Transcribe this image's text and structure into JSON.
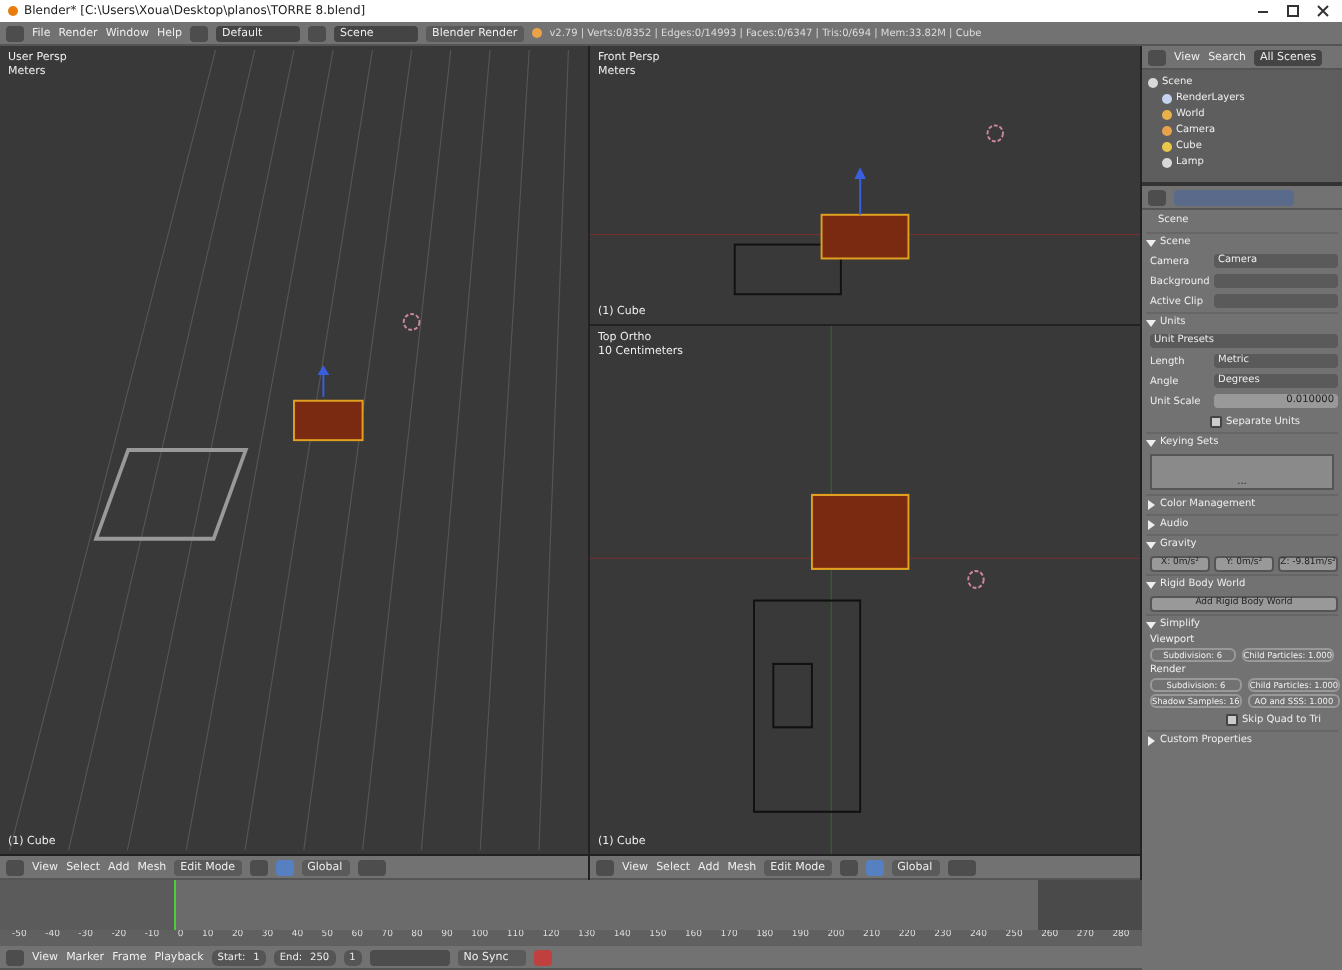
{
  "window": {
    "title": "Blender* [C:\\Users\\Xoua\\Desktop\\planos\\TORRE 8.blend]"
  },
  "info_header": {
    "menus": [
      "File",
      "Render",
      "Window",
      "Help"
    ],
    "layout": "Default",
    "scene": "Scene",
    "engine": "Blender Render",
    "stats": "v2.79 | Verts:0/8352 | Edges:0/14993 | Faces:0/6347 | Tris:0/694 | Mem:33.82M | Cube"
  },
  "viewports": [
    {
      "title": "User Persp",
      "units": "Meters",
      "object": "(1) Cube",
      "kind": "persp"
    },
    {
      "title": "Front Persp",
      "units": "Meters",
      "object": "(1) Cube",
      "kind": "front"
    },
    {
      "title": "Top Ortho",
      "units": "10 Centimeters",
      "object": "(1) Cube",
      "kind": "top"
    }
  ],
  "view3d_headers": [
    {
      "menus": [
        "View",
        "Select",
        "Add",
        "Mesh"
      ],
      "mode": "Edit Mode",
      "orientation": "Global"
    },
    {
      "menus": [
        "View",
        "Select",
        "Add",
        "Mesh"
      ],
      "mode": "Edit Mode",
      "orientation": "Global"
    }
  ],
  "outliner": {
    "menus": [
      "View",
      "Search"
    ],
    "filter": "All Scenes",
    "tree": [
      {
        "label": "Scene",
        "children": [
          {
            "label": "RenderLayers"
          },
          {
            "label": "World"
          },
          {
            "label": "Camera"
          },
          {
            "label": "Cube"
          },
          {
            "label": "Lamp"
          }
        ]
      }
    ]
  },
  "properties": {
    "breadcrumb": "Scene",
    "sections": [
      {
        "kind": "fields",
        "title": "Scene",
        "expanded": true,
        "fields": [
          {
            "label": "Camera",
            "value": "Camera"
          },
          {
            "label": "Background"
          },
          {
            "label": "Active Clip"
          }
        ]
      },
      {
        "kind": "units",
        "title": "Units",
        "expanded": true,
        "preset": "Unit Presets",
        "fields": [
          {
            "label": "Length",
            "value": "Metric"
          },
          {
            "label": "Angle",
            "value": "Degrees"
          },
          {
            "label": "Unit Scale",
            "value": "0.010000"
          }
        ],
        "checkbox": {
          "label": "Separate Units",
          "checked": false
        }
      },
      {
        "kind": "keying",
        "title": "Keying Sets",
        "expanded": true,
        "box": "..."
      },
      {
        "kind": "plain",
        "title": "Color Management",
        "expanded": false
      },
      {
        "kind": "plain",
        "title": "Audio",
        "expanded": false
      },
      {
        "kind": "gravity",
        "title": "Gravity",
        "expanded": true,
        "values": [
          "X: 0m/s²",
          "Y: 0m/s²",
          "Z: -9.81m/s²"
        ]
      },
      {
        "kind": "button",
        "title": "Rigid Body World",
        "expanded": true,
        "button": "Add Rigid Body World"
      },
      {
        "kind": "simplify",
        "title": "Simplify",
        "expanded": true,
        "columns": [
          {
            "heading": "Viewport",
            "items": [
              "Subdivision: 6",
              "Child Particles: 1.000"
            ]
          },
          {
            "heading": "Render",
            "items": [
              "Subdivision: 6",
              "Child Particles: 1.000",
              "Shadow Samples: 16",
              "AO and SSS: 1.000"
            ]
          }
        ],
        "checkbox": {
          "label": "Skip Quad to Tri",
          "checked": false
        }
      },
      {
        "kind": "plain",
        "title": "Custom Properties",
        "expanded": false
      }
    ]
  },
  "timeline": {
    "ticks": [
      "-50",
      "-40",
      "-30",
      "-20",
      "-10",
      "0",
      "10",
      "20",
      "30",
      "40",
      "50",
      "60",
      "70",
      "80",
      "90",
      "100",
      "110",
      "120",
      "130",
      "140",
      "150",
      "160",
      "170",
      "180",
      "190",
      "200",
      "210",
      "220",
      "230",
      "240",
      "250",
      "260",
      "270",
      "280"
    ],
    "playhead": {
      "level": 0.152
    },
    "range_end": {
      "level": 0.909
    },
    "menus": [
      "View",
      "Marker",
      "Frame",
      "Playback"
    ],
    "start": "Start:",
    "start_value": "1",
    "end": "End:",
    "end_value": "250",
    "frame": "1",
    "sync": "No Sync"
  }
}
